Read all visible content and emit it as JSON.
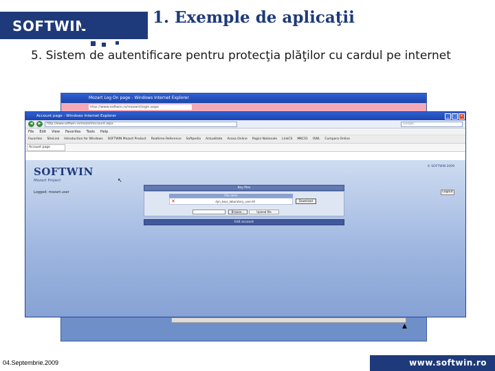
{
  "header": {
    "logo": "SOFTWIN",
    "title": "1. Exemple de aplicaţii",
    "subtitle": "5. Sistem de autentificare pentru protecţia plăţilor cu cardul pe internet"
  },
  "back_window": {
    "title": "Mozart Log On page - Windows Internet Explorer",
    "address": "http://www.softwin.ro/mozart/login.aspx"
  },
  "front_window": {
    "title": "Account page - Windows Internet Explorer",
    "address": "http://www.softwin.ro/mozart/account.aspx",
    "search_placeholder": "Google",
    "menu": [
      "File",
      "Edit",
      "View",
      "Favorites",
      "Tools",
      "Help"
    ],
    "favorites": [
      "Favorites",
      "SiteLink",
      "Introduction for Windows",
      "SOFTWIN Mozart Product",
      "Realtime Reference",
      "Softpedia",
      "Actualitate",
      "Acasa Online",
      "Pagini Nationale",
      "LinkCS",
      "MKCS1",
      "OWL",
      "Cumpara Online"
    ],
    "tab": "Account page",
    "nav_icons": [
      "back-icon",
      "forward-icon"
    ]
  },
  "page": {
    "logo": "SOFTWIN",
    "product": "Mozart Project",
    "logged": "Logged: mozart.user",
    "copyright": "© SOFTWIN 2009",
    "logout": "Logout",
    "key_file_header": "Key files",
    "file_name_header": "File name",
    "file_name_value": "dyn_keys_laboratory_user.dll",
    "download": "Download",
    "browse": "Browse...",
    "upload": "Upload file",
    "edit_account": "Edit account"
  },
  "footer": {
    "date": "04.Septembrie.2009",
    "url": "www.softwin.ro"
  },
  "colors": {
    "brand": "#1e3a7a",
    "page_bg": "#9fb7e0",
    "back_address_bar": "#f4a9b8",
    "title_bar": "#1c45ae"
  }
}
